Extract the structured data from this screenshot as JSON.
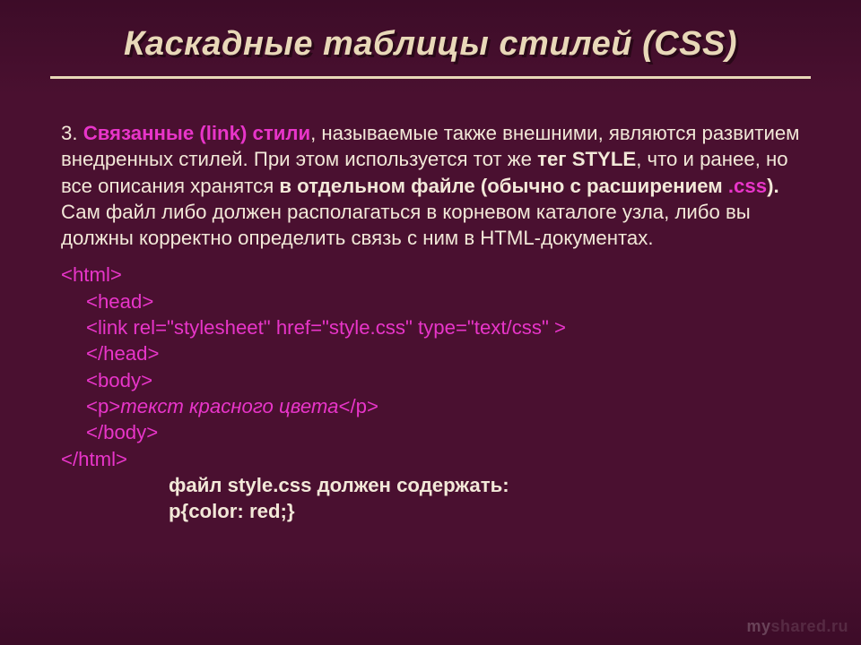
{
  "slide": {
    "title": "Каскадные таблицы стилей (CSS)",
    "list_number": "3.",
    "heading_highlight": "Связанные (link) стили",
    "para_seg1": ", называемые также внешними, являются развитием внедренных стилей. При этом используется тот же ",
    "bold_tag": "тег STYLE",
    "para_seg2": ", что и ранее, но все описания хранятся ",
    "bold_file": "в отдельном файле (обычно с расширением ",
    "ext_css": ".css",
    "bold_file_end": ").",
    "para_seg3": " Сам файл либо должен располагаться в корневом каталоге узла, либо вы должны корректно определить связь с ним в HTML-документах.",
    "code": {
      "l1": "<html>",
      "l2": "<head>",
      "l3": "<link rel=\"stylesheet\" href=\"style.css\" type=\"text/css\" >",
      "l4": "</head>",
      "l5": "<body>",
      "l6_open": "<p>",
      "l6_text": "текст красного цвета",
      "l6_close": "</p>",
      "l7": "</body>",
      "l8": "</html>"
    },
    "note_line1": "файл style.css должен содержать:",
    "note_line2": "p{color: red;}",
    "watermark_left": "my",
    "watermark_right": "shared.ru"
  }
}
